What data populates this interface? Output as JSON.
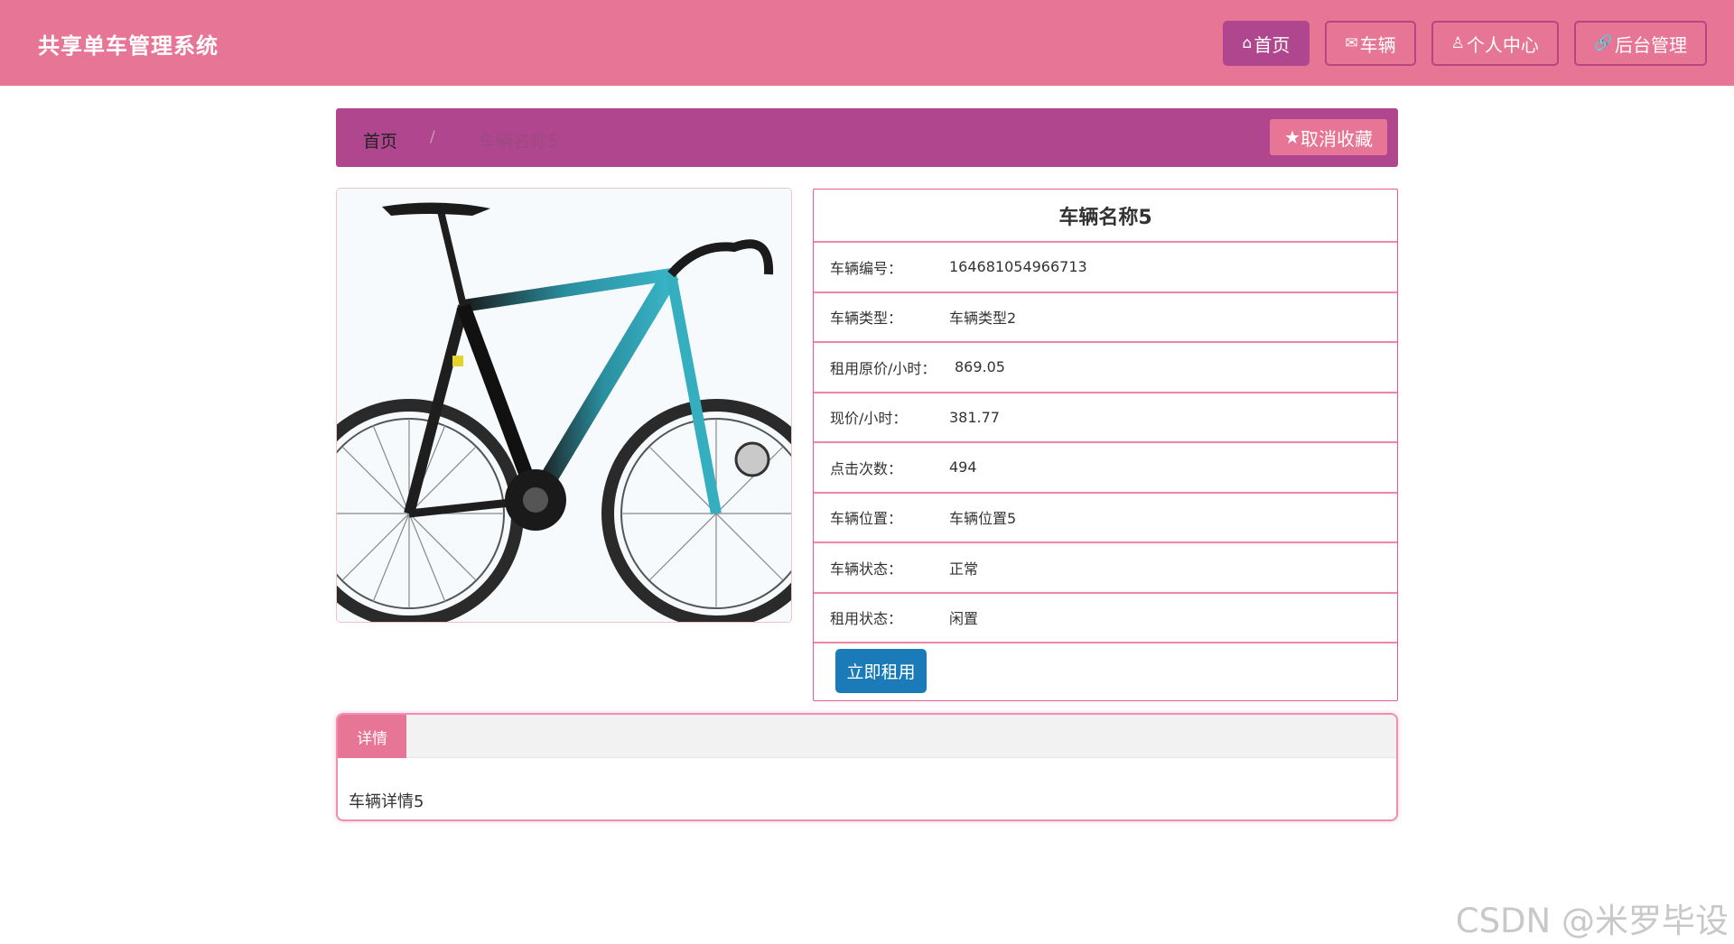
{
  "header": {
    "brand": "共享单车管理系统",
    "nav": [
      {
        "icon": "home-icon",
        "glyph": "⌂",
        "label": "首页"
      },
      {
        "icon": "mail-icon",
        "glyph": "✉",
        "label": "车辆"
      },
      {
        "icon": "user-icon",
        "glyph": "♙",
        "label": "个人中心"
      },
      {
        "icon": "link-icon",
        "glyph": "🔗",
        "label": "后台管理"
      }
    ]
  },
  "breadcrumb": {
    "home": "首页",
    "separator": "/",
    "current": "车辆名称5",
    "favorite_icon": "star-icon",
    "favorite_glyph": "★",
    "favorite_label": "取消收藏"
  },
  "vehicle": {
    "name": "车辆名称5",
    "fields": [
      {
        "label": "车辆编号：",
        "value": "164681054966713"
      },
      {
        "label": "车辆类型：",
        "value": "车辆类型2"
      },
      {
        "label": "租用原价/小时：",
        "value": "869.05"
      },
      {
        "label": "现价/小时：",
        "value": "381.77"
      },
      {
        "label": "点击次数：",
        "value": "494"
      },
      {
        "label": "车辆位置：",
        "value": "车辆位置5"
      },
      {
        "label": "车辆状态：",
        "value": "正常"
      },
      {
        "label": "租用状态：",
        "value": "闲置"
      }
    ],
    "rent_label": "立即租用"
  },
  "detail": {
    "tab": "详情",
    "content": "车辆详情5"
  },
  "watermark": "CSDN @米罗毕设"
}
